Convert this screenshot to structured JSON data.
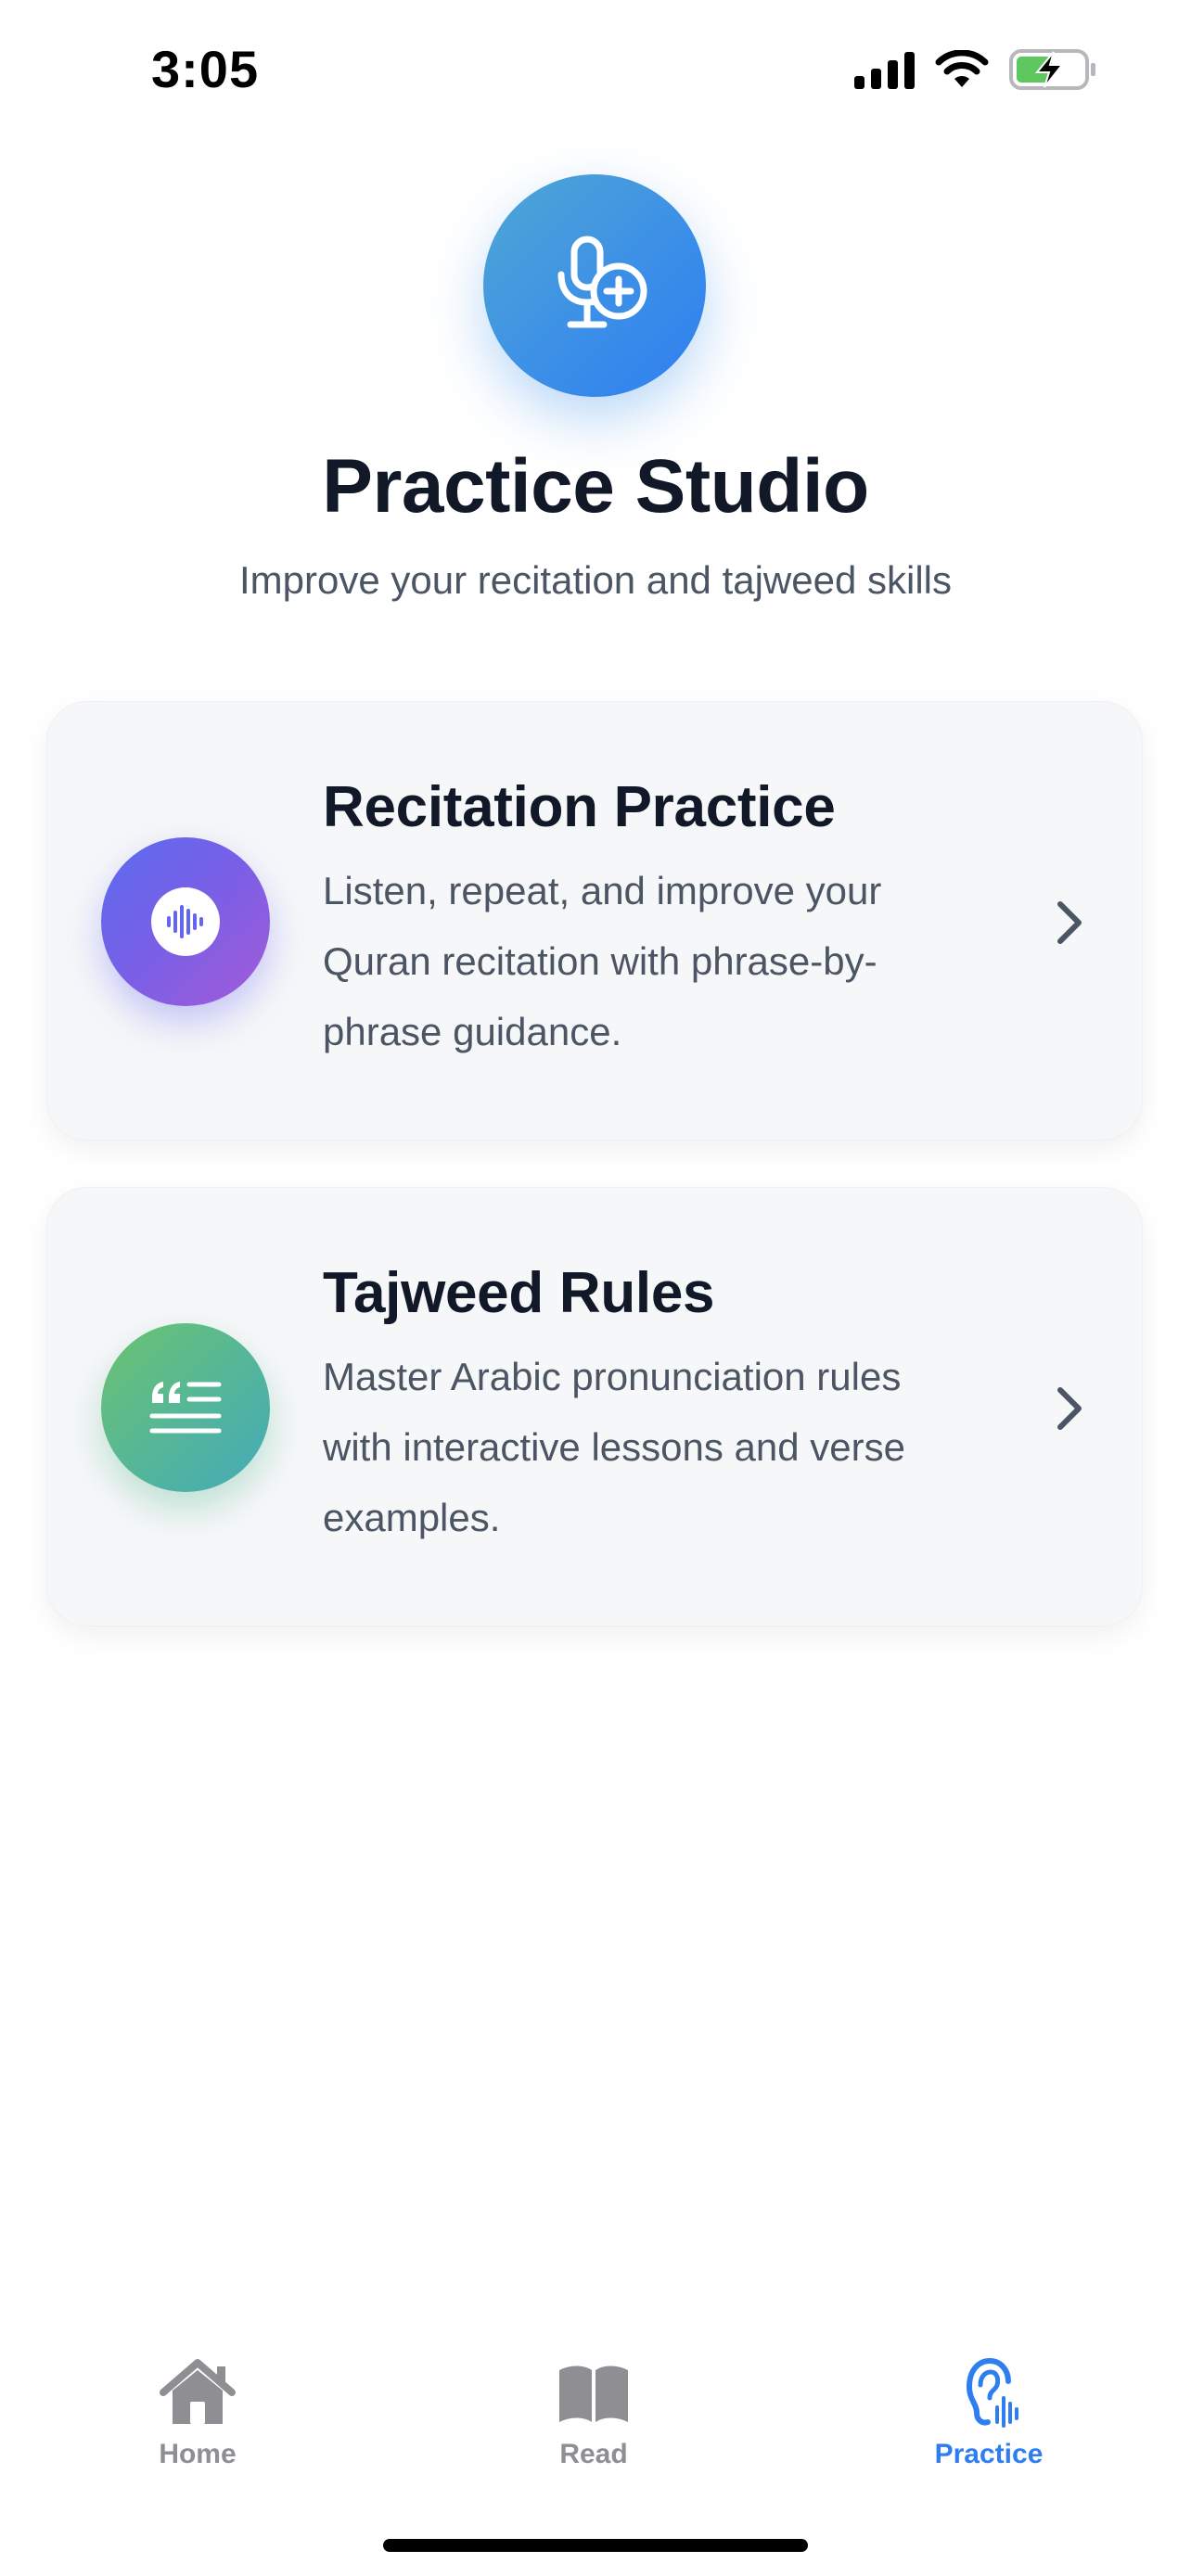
{
  "status_bar": {
    "time": "3:05",
    "icons": [
      "signal-icon",
      "wifi-icon",
      "battery-charging-icon"
    ],
    "battery_color": "#5ec85e"
  },
  "header": {
    "icon": "microphone-plus-icon",
    "title": "Practice Studio",
    "subtitle": "Improve your recitation and tajweed skills",
    "accent": "#3b8ee8"
  },
  "cards": [
    {
      "icon": "audio-waveform-icon",
      "title": "Recitation Practice",
      "description": "Listen, repeat, and improve your Quran recitation with phrase-by-phrase guidance.",
      "gradient": [
        "#5b6cf0",
        "#a35bd6"
      ]
    },
    {
      "icon": "quote-lines-icon",
      "title": "Tajweed Rules",
      "description": "Master Arabic pronunciation rules with interactive lessons and verse examples.",
      "gradient": [
        "#6cc36f",
        "#43aab8"
      ]
    }
  ],
  "tab_bar": {
    "tabs": [
      {
        "label": "Home",
        "icon": "house-icon",
        "active": false
      },
      {
        "label": "Read",
        "icon": "book-icon",
        "active": false
      },
      {
        "label": "Practice",
        "icon": "ear-waveform-icon",
        "active": true
      }
    ],
    "active_color": "#2f7ef0",
    "inactive_color": "#8e8e93"
  }
}
